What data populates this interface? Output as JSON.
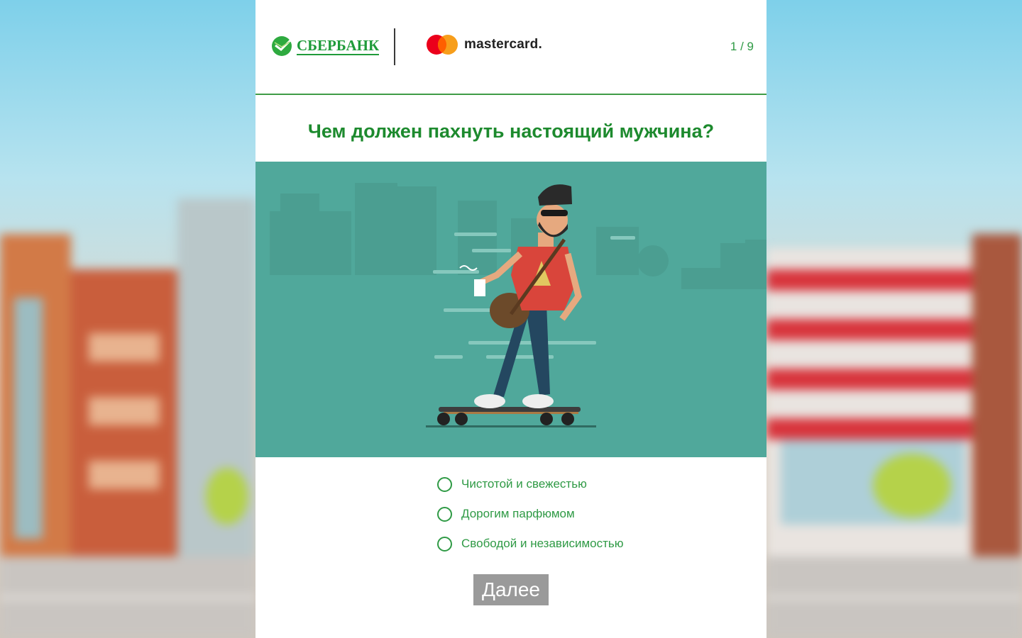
{
  "header": {
    "bank_logo_text": "СБЕРБАНК",
    "partner_logo_text": "mastercard.",
    "progress": "1 / 9"
  },
  "quiz": {
    "question": "Чем должен пахнуть настоящий мужчина?",
    "illustration": "hipster-on-skateboard-with-coffee-in-city",
    "options": [
      {
        "label": "Чистотой и свежестью",
        "selected": false
      },
      {
        "label": "Дорогим парфюмом",
        "selected": false
      },
      {
        "label": "Свободой и независимостью",
        "selected": false
      }
    ],
    "next_button": "Далее"
  },
  "colors": {
    "brand_green": "#1f9b3a",
    "illustration_bg": "#50a89b",
    "button_disabled": "#9a9a9a"
  }
}
